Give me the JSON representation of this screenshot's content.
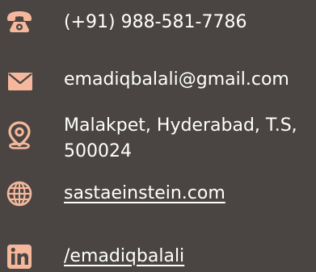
{
  "accent_color": "#f5b89c",
  "contacts": {
    "phone": {
      "icon": "telephone-icon",
      "text": "(+91) 988-581-7786"
    },
    "email": {
      "icon": "envelope-icon",
      "text": "emadiqbalali@gmail.com"
    },
    "address": {
      "icon": "location-pin-icon",
      "line1": "Malakpet, Hyderabad, T.S,",
      "line2": "500024"
    },
    "website": {
      "icon": "globe-icon",
      "text": "sastaeinstein.com"
    },
    "linkedin": {
      "icon": "linkedin-icon",
      "text": "/emadiqbalali"
    }
  }
}
